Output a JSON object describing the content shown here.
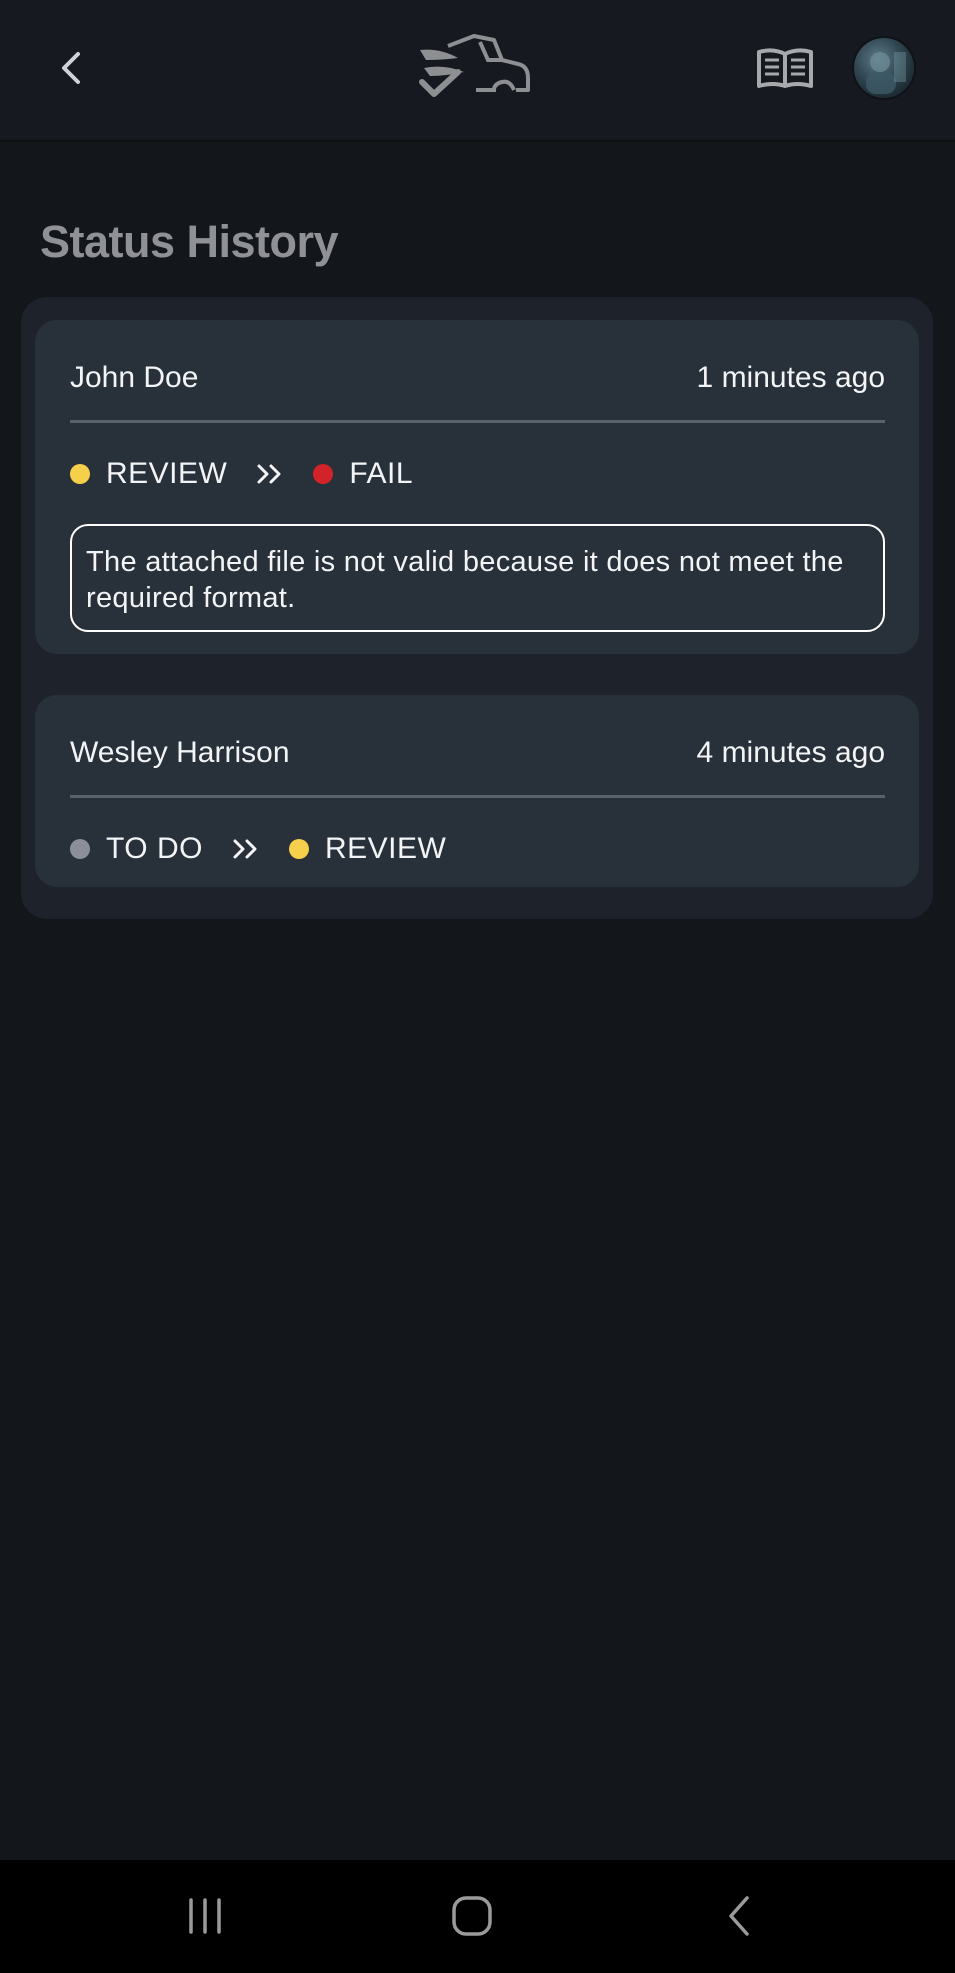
{
  "header": {
    "back_icon": "chevron-left-icon",
    "logo_icon": "truck-check-logo",
    "book_icon": "open-book-icon",
    "avatar": "user-avatar"
  },
  "page": {
    "title": "Status History"
  },
  "status_colors": {
    "REVIEW": "#f6cf4b",
    "FAIL": "#d3232a",
    "TO DO": "#8a8f99"
  },
  "entries": [
    {
      "user": "John Doe",
      "time": "1 minutes ago",
      "from_status": "REVIEW",
      "to_status": "FAIL",
      "comment": "The attached file is not valid because it does not meet the required format."
    },
    {
      "user": "Wesley Harrison",
      "time": "4 minutes ago",
      "from_status": "TO DO",
      "to_status": "REVIEW"
    }
  ],
  "navbar": {
    "recents_icon": "recents-icon",
    "home_icon": "home-icon",
    "back_icon": "nav-back-icon"
  }
}
